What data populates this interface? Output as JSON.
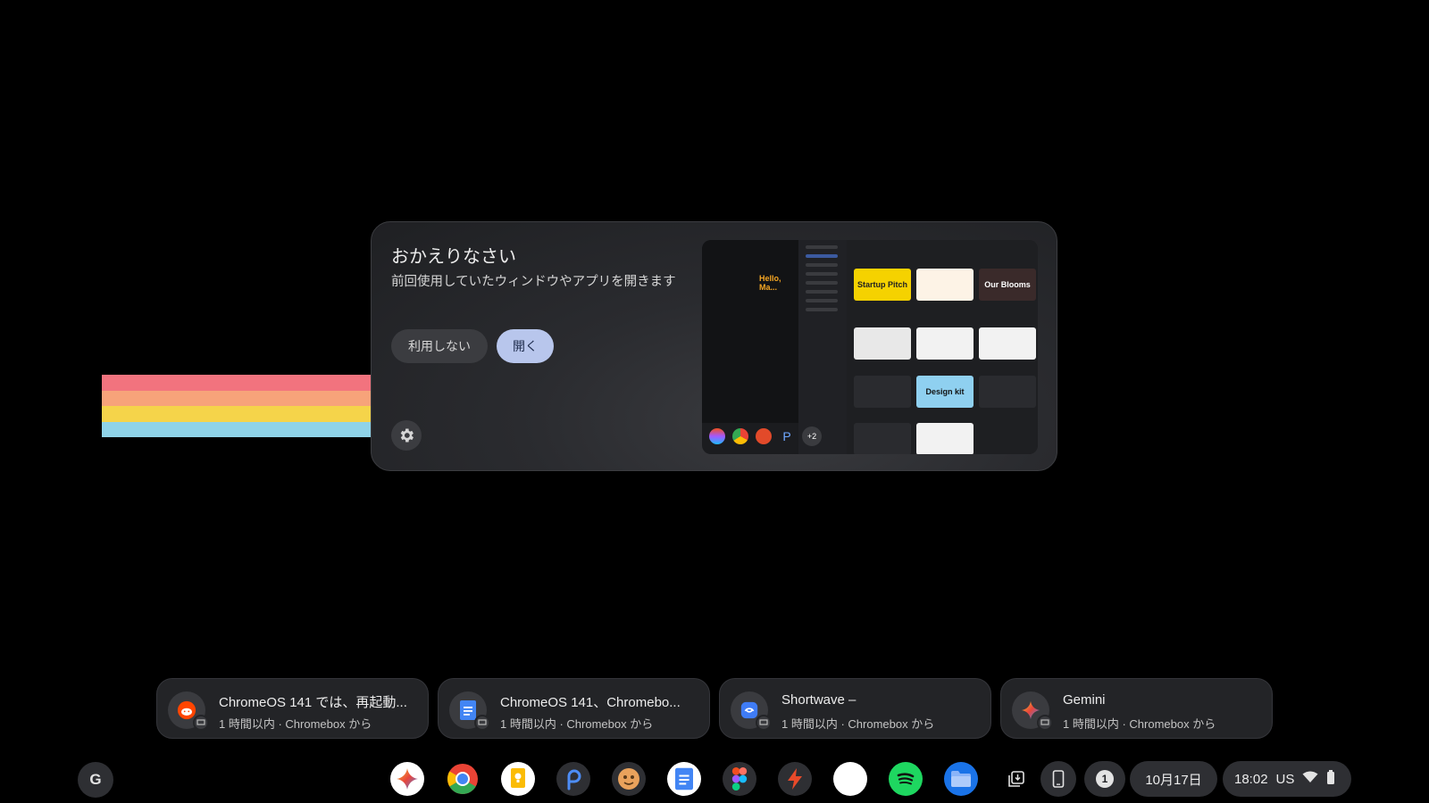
{
  "wallpaper": {
    "stripe_colors": [
      "#f2737e",
      "#f7a37a",
      "#f5d44a",
      "#8fd3e8"
    ]
  },
  "dialog": {
    "title": "おかえりなさい",
    "description": "前回使用していたウィンドウやアプリを開きます",
    "decline_label": "利用しない",
    "open_label": "開く",
    "preview": {
      "hello_text": "Hello, Ma...",
      "tiles": [
        "Startup Pitch",
        "Our Blooms",
        "Design kit"
      ],
      "more_apps_badge": "+2"
    }
  },
  "suggestions": [
    {
      "title": "ChromeOS 141 では、再起動...",
      "subtitle": "1 時間以内 · Chromebox から",
      "icon": "reddit-icon"
    },
    {
      "title": "ChromeOS 141、Chromebo...",
      "subtitle": "1 時間以内 · Chromebox から",
      "icon": "docs-icon"
    },
    {
      "title": "Shortwave –",
      "subtitle": "1 時間以内 · Chromebox から",
      "icon": "shortwave-icon"
    },
    {
      "title": "Gemini",
      "subtitle": "1 時間以内 · Chromebox から",
      "icon": "gemini-icon"
    }
  ],
  "shelf": {
    "launcher_label": "G",
    "apps": [
      "gemini",
      "chrome",
      "keep",
      "shortwave-p",
      "photos-like",
      "docs",
      "figma",
      "spark",
      "blank",
      "spotify",
      "files"
    ]
  },
  "tray": {
    "notification_count": "1",
    "date": "10月17日",
    "time": "18:02",
    "ime": "US"
  },
  "colors": {
    "accent": "#b8c6ec",
    "surface": "#232427",
    "shelf": "#2e2f33"
  }
}
